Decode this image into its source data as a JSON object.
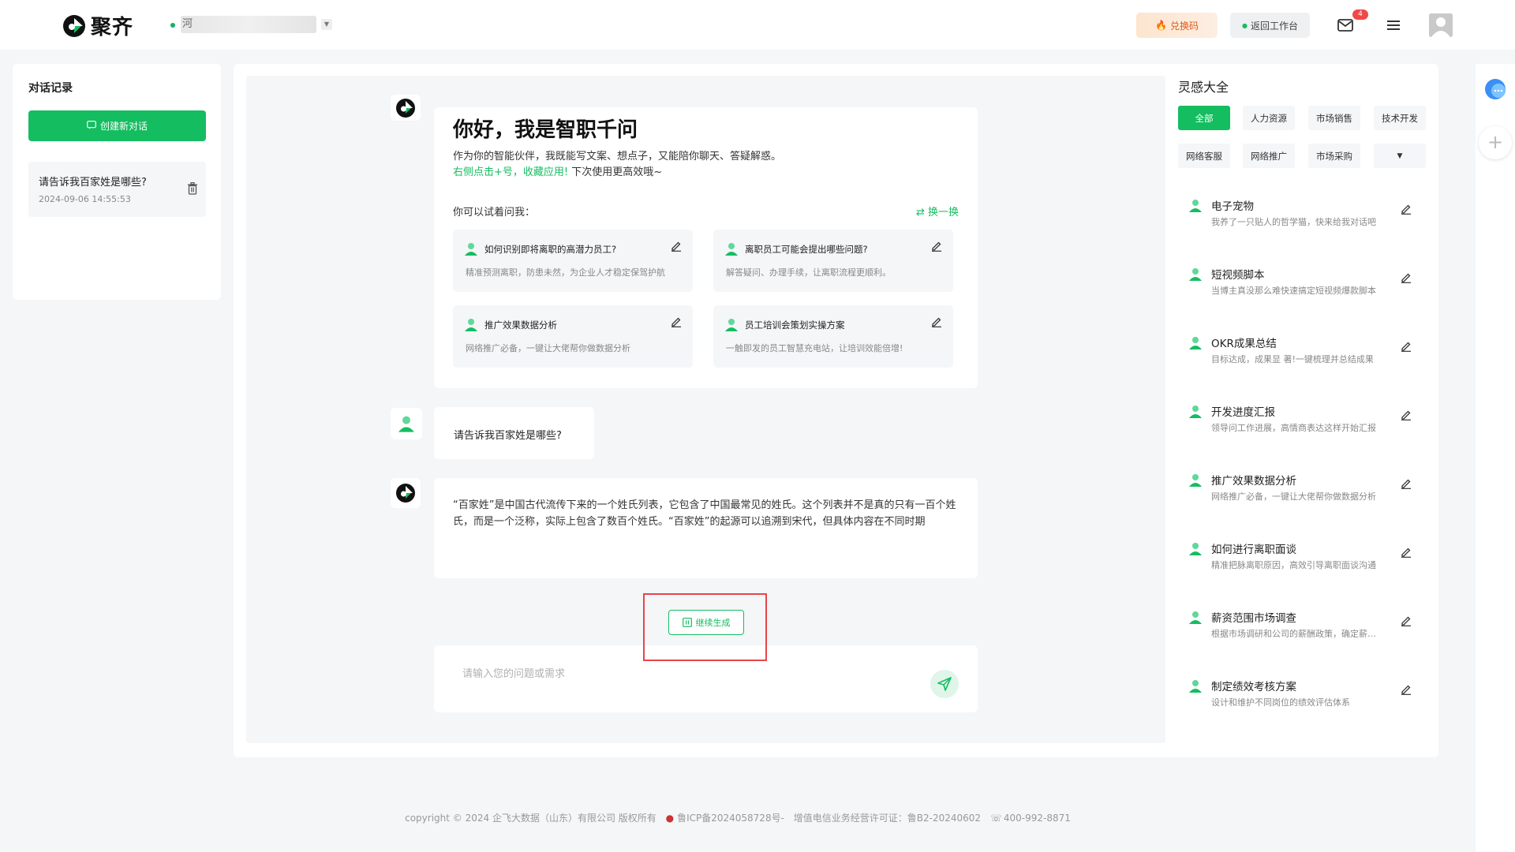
{
  "header": {
    "brand": "聚齐",
    "workspace_name": "河",
    "redeem_label": "兑换码",
    "back_label": "返回工作台",
    "mail_badge": "4"
  },
  "history": {
    "title": "对话记录",
    "new_chat_label": "创建新对话",
    "items": [
      {
        "title": "请告诉我百家姓是哪些?",
        "time": "2024-09-06 14:55:53"
      }
    ]
  },
  "welcome": {
    "title": "你好，我是智职千问",
    "desc": "作为你的智能伙伴，我既能写文案、想点子，又能陪你聊天、答疑解惑。",
    "hint_green": "右侧点击+号，收藏应用!",
    "hint_rest": " 下次使用更高效哦~",
    "try_label": "你可以试着问我：",
    "swap_label": "换一换",
    "suggestions": [
      {
        "title": "如何识别即将离职的高潜力员工?",
        "desc": "精准预测离职，防患未然，为企业人才稳定保驾护航"
      },
      {
        "title": "离职员工可能会提出哪些问题?",
        "desc": "解答疑问、办理手续，让离职流程更顺利。"
      },
      {
        "title": "推广效果数据分析",
        "desc": "网络推广必备，一键让大佬帮你做数据分析"
      },
      {
        "title": "员工培训会策划实操方案",
        "desc": "一触即发的员工智慧充电站，让培训效能倍增!"
      }
    ]
  },
  "conversation": {
    "user_message": "请告诉我百家姓是哪些?",
    "bot_message": "“百家姓”是中国古代流传下来的一个姓氏列表，它包含了中国最常见的姓氏。这个列表并不是真的只有一百个姓氏，而是一个泛称，实际上包含了数百个姓氏。“百家姓”的起源可以追溯到宋代，但具体内容在不同时期",
    "continue_label": "继续生成",
    "input_placeholder": "请输入您的问题或需求"
  },
  "inspiration": {
    "title": "灵感大全",
    "categories": [
      "全部",
      "人力资源",
      "市场销售",
      "技术开发",
      "网络客服",
      "网络推广",
      "市场采购"
    ],
    "items": [
      {
        "name": "电子宠物",
        "desc": "我养了一只贴人的哲学猫，快来给我对话吧"
      },
      {
        "name": "短视频脚本",
        "desc": "当博主真没那么难快速搞定短视频爆款脚本"
      },
      {
        "name": "OKR成果总结",
        "desc": "目标达成，成果显 著!一键梳理并总结成果"
      },
      {
        "name": "开发进度汇报",
        "desc": "领导问工作进展，高情商表达这样开始汇报"
      },
      {
        "name": "推广效果数据分析",
        "desc": "网络推广必备，一键让大佬帮你做数据分析"
      },
      {
        "name": "如何进行离职面谈",
        "desc": "精准把脉离职原因，高效引导离职面谈沟通"
      },
      {
        "name": "薪资范围市场调查",
        "desc": "根据市场调研和公司的薪酬政策，确定薪资范围"
      },
      {
        "name": "制定绩效考核方案",
        "desc": "设计和维护不同岗位的绩效评估体系"
      }
    ]
  },
  "footer": {
    "copyright": "copyright © 2024 企飞大数据（山东）有限公司 版权所有",
    "icp": "鲁ICP备2024058728号-",
    "license": "增值电信业务经营许可证：鲁B2-20240602",
    "phone": "400-992-8871"
  },
  "colors": {
    "accent": "#15bd61",
    "highlight_box": "#e8454a"
  }
}
